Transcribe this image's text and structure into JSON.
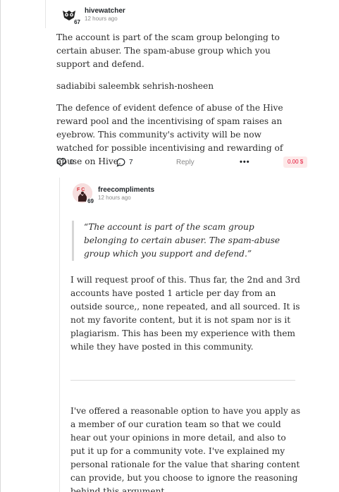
{
  "comment": {
    "author": "hivewatcher",
    "reputation": "67",
    "time": "12 hours ago",
    "paragraphs": [
      "The account is part of the scam group belonging to certain abuser. The spam-abuse group which you support and defend.",
      "sadiabibi saleembk sehrish-nosheen",
      "The defence of evident defence of abuse of the Hive reward pool and the incentivising of spam raises an eyebrow. This community's activity will be now watched for possible incentivising and rewarding of abuse on Hive."
    ],
    "actions": {
      "upvotes": "0",
      "replies": "7",
      "reply_label": "Reply",
      "more_label": "•••",
      "payout": "0.00 $"
    }
  },
  "reply": {
    "author": "freecompliments",
    "reputation": "69",
    "time": "12 hours ago",
    "quote": "“The account is part of the scam group belonging to certain abuser. The spam-abuse group which you support and defend.”",
    "paragraph1": "I will request proof of this. Thus far, the 2nd and 3rd accounts have posted 1 article per day from an outside source,, none repeated, and all sourced. It is not my favorite content, but it is not spam nor is it plagiarism. This has been my experience with them while they have posted in this community.",
    "paragraph2": "I've offered a reasonable option to have you apply as a member of our curation team so that we could hear out your opinions in more detail, and also to put it up for a community vote. I've explained my personal rationale for the value that sharing content can provide, but you choose to ignore the reasoning behind this argument."
  },
  "colors": {
    "payout_bg": "#fde9e9",
    "payout_text": "#e31337",
    "muted": "#8a8a8a"
  },
  "icons": {
    "upvote": "chevron-up-circle-icon",
    "comments": "speech-bubble-icon",
    "more": "ellipsis-icon"
  }
}
